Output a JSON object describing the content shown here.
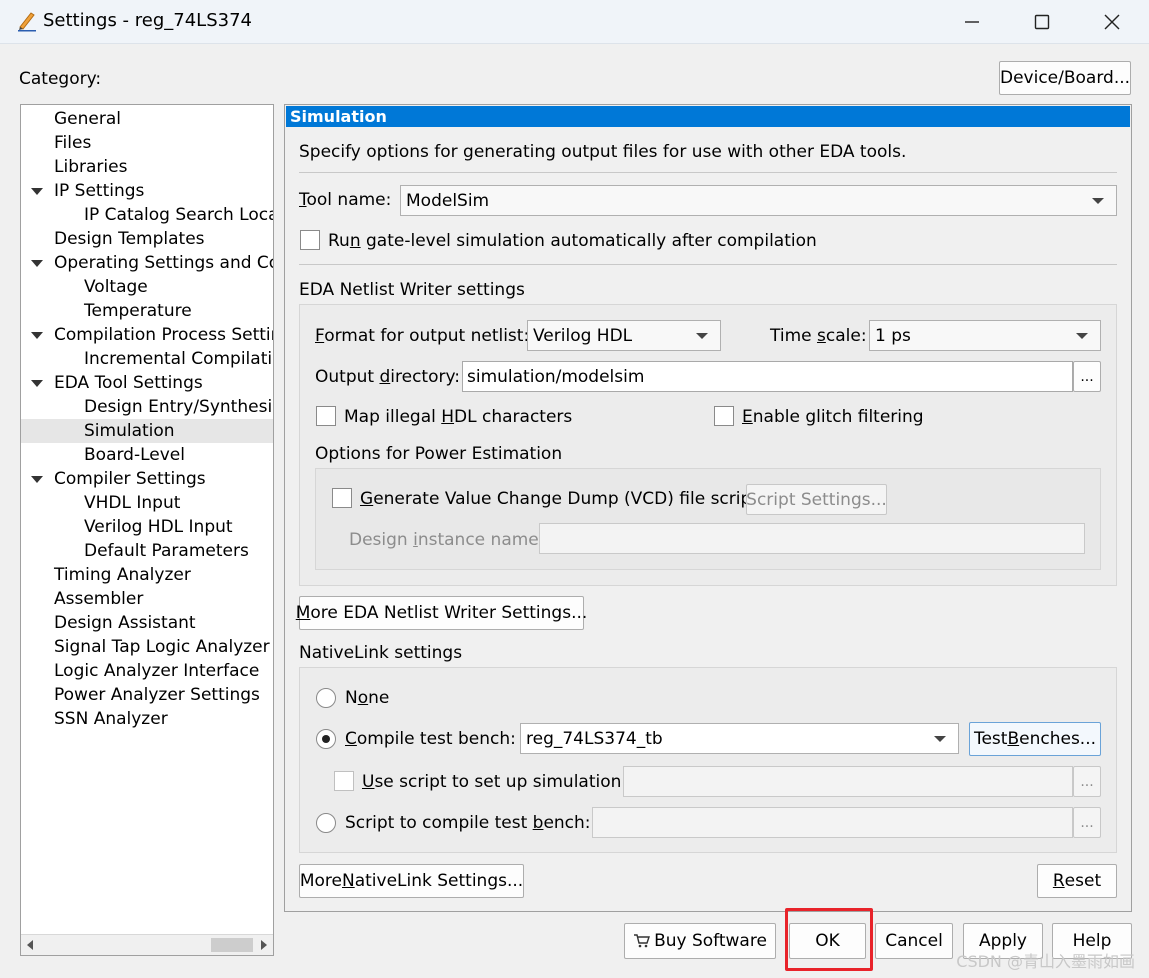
{
  "window": {
    "title": "Settings - reg_74LS374"
  },
  "category_label": "Category:",
  "device_board_button": "Device/Board...",
  "tree": [
    {
      "label": "General",
      "level": 0,
      "expanded": false
    },
    {
      "label": "Files",
      "level": 0,
      "expanded": false
    },
    {
      "label": "Libraries",
      "level": 0,
      "expanded": false
    },
    {
      "label": "IP Settings",
      "level": 0,
      "expanded": true
    },
    {
      "label": "IP Catalog Search Locat",
      "level": 1,
      "expanded": false
    },
    {
      "label": "Design Templates",
      "level": 0,
      "expanded": false
    },
    {
      "label": "Operating Settings and Cor",
      "level": 0,
      "expanded": true
    },
    {
      "label": "Voltage",
      "level": 1,
      "expanded": false
    },
    {
      "label": "Temperature",
      "level": 1,
      "expanded": false
    },
    {
      "label": "Compilation Process Settin",
      "level": 0,
      "expanded": true
    },
    {
      "label": "Incremental Compilatio",
      "level": 1,
      "expanded": false
    },
    {
      "label": "EDA Tool Settings",
      "level": 0,
      "expanded": true
    },
    {
      "label": "Design Entry/Synthesis",
      "level": 1,
      "expanded": false
    },
    {
      "label": "Simulation",
      "level": 1,
      "expanded": false,
      "selected": true
    },
    {
      "label": "Board-Level",
      "level": 1,
      "expanded": false
    },
    {
      "label": "Compiler Settings",
      "level": 0,
      "expanded": true
    },
    {
      "label": "VHDL Input",
      "level": 1,
      "expanded": false
    },
    {
      "label": "Verilog HDL Input",
      "level": 1,
      "expanded": false
    },
    {
      "label": "Default Parameters",
      "level": 1,
      "expanded": false
    },
    {
      "label": "Timing Analyzer",
      "level": 0,
      "expanded": false
    },
    {
      "label": "Assembler",
      "level": 0,
      "expanded": false
    },
    {
      "label": "Design Assistant",
      "level": 0,
      "expanded": false
    },
    {
      "label": "Signal Tap Logic Analyzer",
      "level": 0,
      "expanded": false
    },
    {
      "label": "Logic Analyzer Interface",
      "level": 0,
      "expanded": false
    },
    {
      "label": "Power Analyzer Settings",
      "level": 0,
      "expanded": false
    },
    {
      "label": "SSN Analyzer",
      "level": 0,
      "expanded": false
    }
  ],
  "panel": {
    "header": "Simulation",
    "description": "Specify options for generating output files for use with other EDA tools.",
    "tool_name": {
      "label_u": "T",
      "label_rest": "ool name:",
      "value": "ModelSim"
    },
    "run_gate_level": {
      "pre": "Ru",
      "u": "n",
      "post": " gate-level simulation automatically after compilation",
      "checked": false
    },
    "netlist_section": "EDA Netlist Writer settings",
    "format": {
      "u": "F",
      "rest": "ormat for output netlist:",
      "value": "Verilog HDL"
    },
    "time_scale": {
      "pre": "Time ",
      "u": "s",
      "post": "cale:",
      "value": "1 ps"
    },
    "output_dir": {
      "pre": "Output ",
      "u": "d",
      "post": "irectory:",
      "value": "simulation/modelsim",
      "browse": "..."
    },
    "map_illegal": {
      "pre": "Map illegal ",
      "u": "H",
      "post": "DL characters",
      "checked": false
    },
    "enable_glitch": {
      "u": "E",
      "rest": "nable glitch filtering",
      "checked": false
    },
    "power_section": "Options for Power Estimation",
    "vcd": {
      "u": "G",
      "rest": "enerate Value Change Dump (VCD) file script",
      "checked": false
    },
    "script_settings_button": "Script Settings...",
    "design_instance": {
      "pre": "Design ",
      "u": "i",
      "post": "nstance name:",
      "value": ""
    },
    "more_netlist_button": {
      "u": "M",
      "rest": "ore EDA Netlist Writer Settings..."
    },
    "nativelink_section": "NativeLink settings",
    "none_option": {
      "pre": "N",
      "u": "o",
      "post": "ne",
      "checked": false
    },
    "compile_tb": {
      "u": "C",
      "rest": "ompile test bench:",
      "value": "reg_74LS374_tb",
      "checked": true
    },
    "test_benches_button": {
      "pre": "Test ",
      "u": "B",
      "post": "enches..."
    },
    "use_script": {
      "u": "U",
      "rest": "se script to set up simulation:",
      "value": "",
      "browse": "...",
      "checked": false
    },
    "script_compile_tb": {
      "pre": "Script to compile test ",
      "u": "b",
      "post": "ench:",
      "value": "",
      "browse": "...",
      "checked": false
    },
    "more_nativelink_button": {
      "pre": "More ",
      "u": "N",
      "post": "ativeLink Settings..."
    },
    "reset_button": {
      "u": "R",
      "rest": "eset"
    }
  },
  "footer": {
    "buy_software": "Buy Software",
    "ok": "OK",
    "cancel": "Cancel",
    "apply": "Apply",
    "help": "Help"
  },
  "watermark": "CSDN @青山入墨雨如画",
  "colors": {
    "header_blue": "#0078d7",
    "highlight_red": "#e8232a"
  }
}
